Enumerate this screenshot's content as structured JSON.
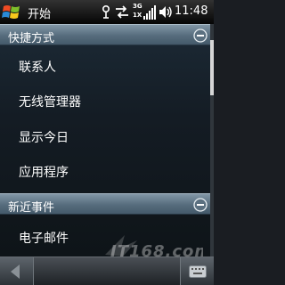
{
  "title_bar": {
    "app_title": "开始",
    "clock": "11:48",
    "signal_type": "3G",
    "network_badge": "1X"
  },
  "sections": [
    {
      "label": "快捷方式",
      "items": [
        {
          "label": "联系人"
        },
        {
          "label": "无线管理器"
        },
        {
          "label": "显示今日"
        },
        {
          "label": "应用程序"
        }
      ]
    },
    {
      "label": "新近事件",
      "items": [
        {
          "label": "电子邮件"
        }
      ]
    }
  ],
  "watermark": "IT168.com",
  "colors": {
    "section_header": "#566c7d",
    "content_bg": "#141c24",
    "title_bar": "#050505"
  }
}
